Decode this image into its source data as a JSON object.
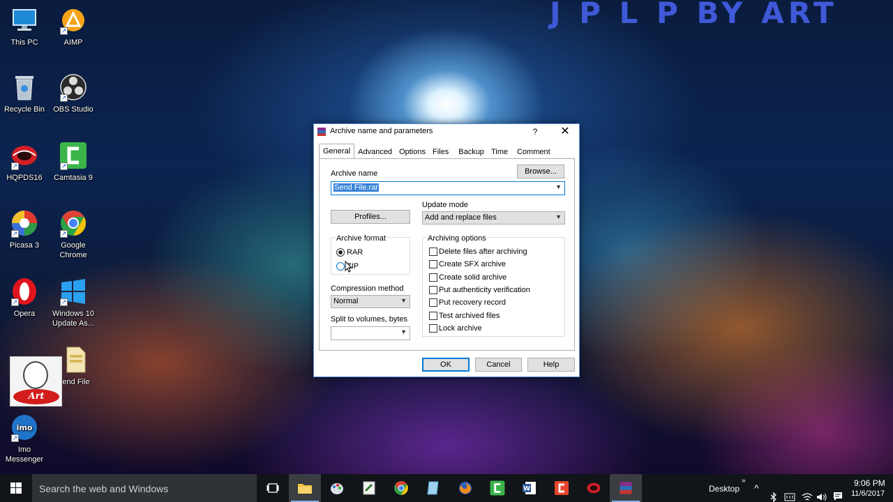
{
  "watermark": "J P L P BY ART",
  "desktop_icons": {
    "this_pc": "This PC",
    "aimp": "AIMP",
    "recycle_bin": "Recycle Bin",
    "obs": "OBS Studio",
    "hqpds": "HQPDS16",
    "camtasia": "Camtasia 9",
    "picasa": "Picasa 3",
    "chrome": "Google Chrome",
    "opera": "Opera",
    "win10": "Windows 10 Update As...",
    "sendfile": "end File",
    "art_logo": "Art",
    "imo": "Imo Messenger"
  },
  "dialog": {
    "title": "Archive name and parameters",
    "help_glyph": "?",
    "close_glyph": "✕",
    "tabs": [
      "General",
      "Advanced",
      "Options",
      "Files",
      "Backup",
      "Time",
      "Comment"
    ],
    "archive_name_label": "Archive name",
    "browse": "Browse...",
    "archive_name_value": "Send File.rar",
    "profiles": "Profiles...",
    "update_mode_label": "Update mode",
    "update_mode_value": "Add and replace files",
    "archive_format_label": "Archive format",
    "format_rar": "RAR",
    "format_zip": "ZIP",
    "format_selected": "RAR",
    "compression_label": "Compression method",
    "compression_value": "Normal",
    "split_label": "Split to volumes, bytes",
    "split_value": "",
    "archiving_options_label": "Archiving options",
    "options": [
      {
        "label": "Delete files after archiving",
        "checked": false
      },
      {
        "label": "Create SFX archive",
        "checked": false
      },
      {
        "label": "Create solid archive",
        "checked": false
      },
      {
        "label": "Put authenticity verification",
        "checked": false
      },
      {
        "label": "Put recovery record",
        "checked": false
      },
      {
        "label": "Test archived files",
        "checked": false
      },
      {
        "label": "Lock archive",
        "checked": false
      }
    ],
    "ok": "OK",
    "cancel": "Cancel",
    "help": "Help"
  },
  "taskbar": {
    "search_placeholder": "Search the web and Windows",
    "desktop_label": "Desktop",
    "time": "9:06 PM",
    "date": "11/6/2017"
  }
}
